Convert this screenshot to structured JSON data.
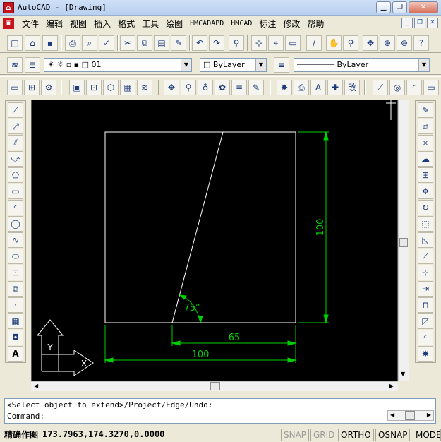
{
  "window": {
    "title": "AutoCAD - [Drawing]",
    "app_icon": "cad-app-icon"
  },
  "menu": [
    "文件",
    "编辑",
    "视图",
    "插入",
    "格式",
    "工具",
    "绘图",
    "HMCADAPD",
    "HMCAD",
    "标注",
    "修改",
    "帮助"
  ],
  "layer": {
    "current": "01",
    "color": "ByLayer",
    "linetype": "ByLayer"
  },
  "drawing": {
    "dim_vertical": "100",
    "dim_inner": "65",
    "dim_bottom": "100",
    "angle": "75°",
    "ucs_x": "X",
    "ucs_y": "Y"
  },
  "command": {
    "history": "<Select object to extend>/Project/Edge/Undo:",
    "prompt": "Command:"
  },
  "status": {
    "label": "精确作图",
    "coords": "173.7963,174.3270,0.0000",
    "modes": [
      {
        "label": "SNAP",
        "on": false
      },
      {
        "label": "GRID",
        "on": false
      },
      {
        "label": "ORTHO",
        "on": true
      },
      {
        "label": "OSNAP",
        "on": true
      },
      {
        "label": "MODE",
        "on": true
      }
    ]
  },
  "colors": {
    "canvas": "#000000",
    "geometry": "#ffffff",
    "dimension": "#00d000"
  }
}
